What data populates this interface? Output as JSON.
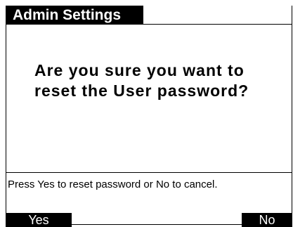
{
  "header": {
    "title": "Admin Settings"
  },
  "dialog": {
    "message_line1": "Are you sure you want to",
    "message_line2": "reset the User password?"
  },
  "footer": {
    "hint": "Press Yes to reset password or No to cancel.",
    "yes_label": "Yes",
    "no_label": "No"
  }
}
